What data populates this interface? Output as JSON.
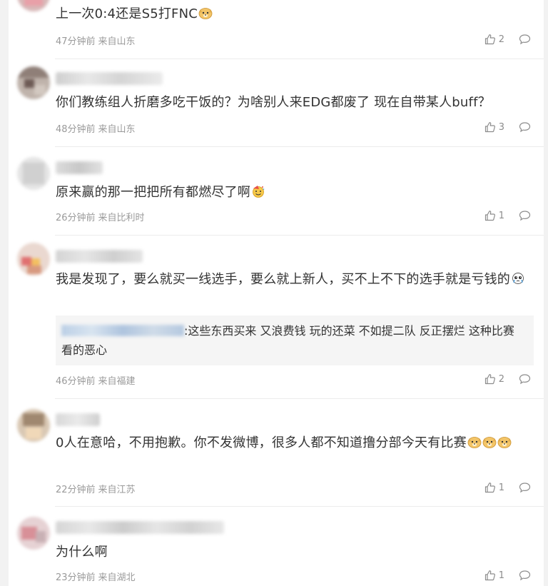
{
  "comments": [
    {
      "text": "上一次0:4还是S5打FNC",
      "emojis": [
        "doge-emoji"
      ],
      "time": "47分钟前",
      "location": "来自山东",
      "likes": "2"
    },
    {
      "text": "你们教练组人折磨多吃干饭的？为啥别人来EDG都废了 现在自带某人buff？",
      "emojis": [],
      "time": "48分钟前",
      "location": "来自山东",
      "likes": "3"
    },
    {
      "text": "原来赢的那一把把所有都燃尽了啊",
      "emojis": [
        "party-emoji"
      ],
      "time": "26分钟前",
      "location": "来自比利时",
      "likes": "1"
    },
    {
      "text": "我是发现了，要么就买一线选手，要么就上新人，买不上不下的选手就是亏钱的",
      "emojis": [
        "crying-emoji"
      ],
      "quote": ":这些东西买来 又浪费钱 玩的还菜 不如提二队 反正摆烂 这种比赛看的恶心",
      "time": "46分钟前",
      "location": "来自福建",
      "likes": "2"
    },
    {
      "text": "0人在意哈，不用抱歉。你不发微博，很多人都不知道撸分部今天有比赛",
      "emojis": [
        "doge-emoji",
        "doge-emoji",
        "doge-emoji"
      ],
      "time": "22分钟前",
      "location": "来自江苏",
      "likes": "1"
    },
    {
      "text": "为什么啊",
      "emojis": [],
      "time": "23分钟前",
      "location": "来自湖北",
      "likes": "1"
    }
  ],
  "colors": {
    "text": "#333333",
    "meta": "#9a9a9a",
    "action": "#8c8c8c",
    "quote_bg": "#f5f5f5",
    "divider": "#ececec"
  }
}
